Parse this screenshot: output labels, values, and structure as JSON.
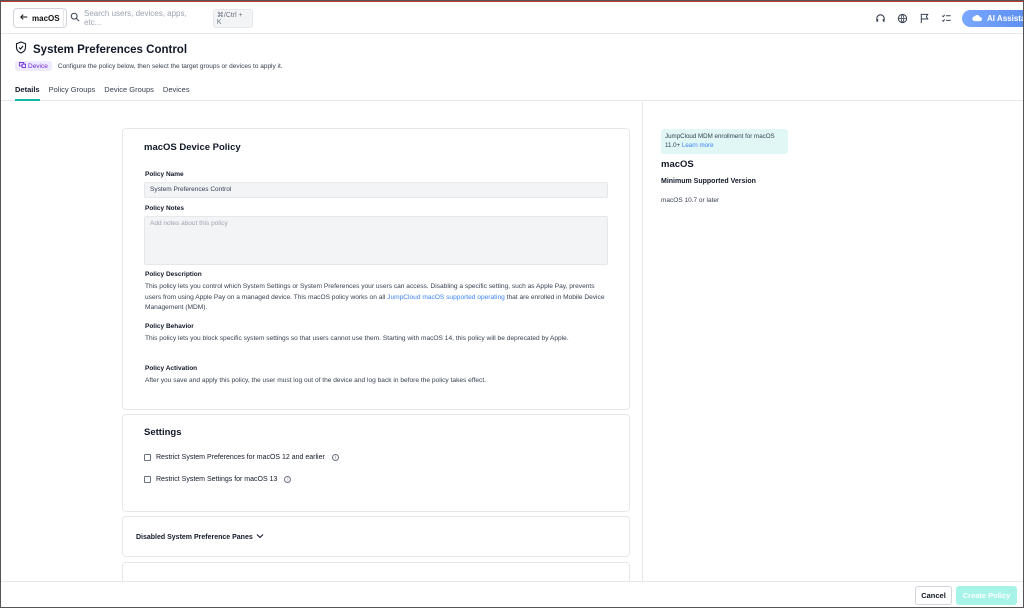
{
  "topbar": {
    "back_label": "macOS",
    "search_placeholder": "Search users, devices, apps, etc...",
    "search_shortcut": "⌘/Ctrl + K",
    "ai_label": "AI Assista"
  },
  "header": {
    "title": "System Preferences Control",
    "badge": "Device",
    "subtitle": "Configure the policy below, then select the target groups or devices to apply it.",
    "tabs": [
      {
        "label": "Details"
      },
      {
        "label": "Policy Groups"
      },
      {
        "label": "Device Groups"
      },
      {
        "label": "Devices"
      }
    ]
  },
  "policy_card": {
    "title": "macOS Device Policy",
    "name_label": "Policy Name",
    "name_value": "System Preferences Control",
    "notes_label": "Policy Notes",
    "notes_placeholder": "Add notes about this policy",
    "description_label": "Policy Description",
    "description_text_1": "This policy lets you control which System Settings or System Preferences your users can access. Disabling a specific setting, such as Apple Pay, prevents users from using Apple Pay on a managed device. This macOS policy works on all ",
    "description_link": "JumpCloud macOS supported operating",
    "description_text_2": " that are enrolled in Mobile Device Management (MDM).",
    "behavior_label": "Policy Behavior",
    "behavior_text": "This policy lets you block specific system settings so that users cannot use them. Starting with macOS 14, this policy will be deprecated by Apple.",
    "activation_label": "Policy Activation",
    "activation_text": "After you save and apply this policy, the user must log out of the device and log back in before the policy takes effect."
  },
  "settings_card": {
    "title": "Settings",
    "options": [
      {
        "label": "Restrict System Preferences for macOS 12 and earlier",
        "checked": false
      },
      {
        "label": "Restrict System Settings for macOS 13",
        "checked": false
      }
    ]
  },
  "panes_card": {
    "label": "Disabled System Preference Panes"
  },
  "right_panel": {
    "notice_text": "JumpCloud MDM enrollment for macOS 11.0+ ",
    "notice_link": "Learn more",
    "os_title": "macOS",
    "min_version_label": "Minimum Supported Version",
    "min_version_value": "macOS 10.7 or later"
  },
  "footer": {
    "cancel_label": "Cancel",
    "create_label": "Create Policy"
  }
}
